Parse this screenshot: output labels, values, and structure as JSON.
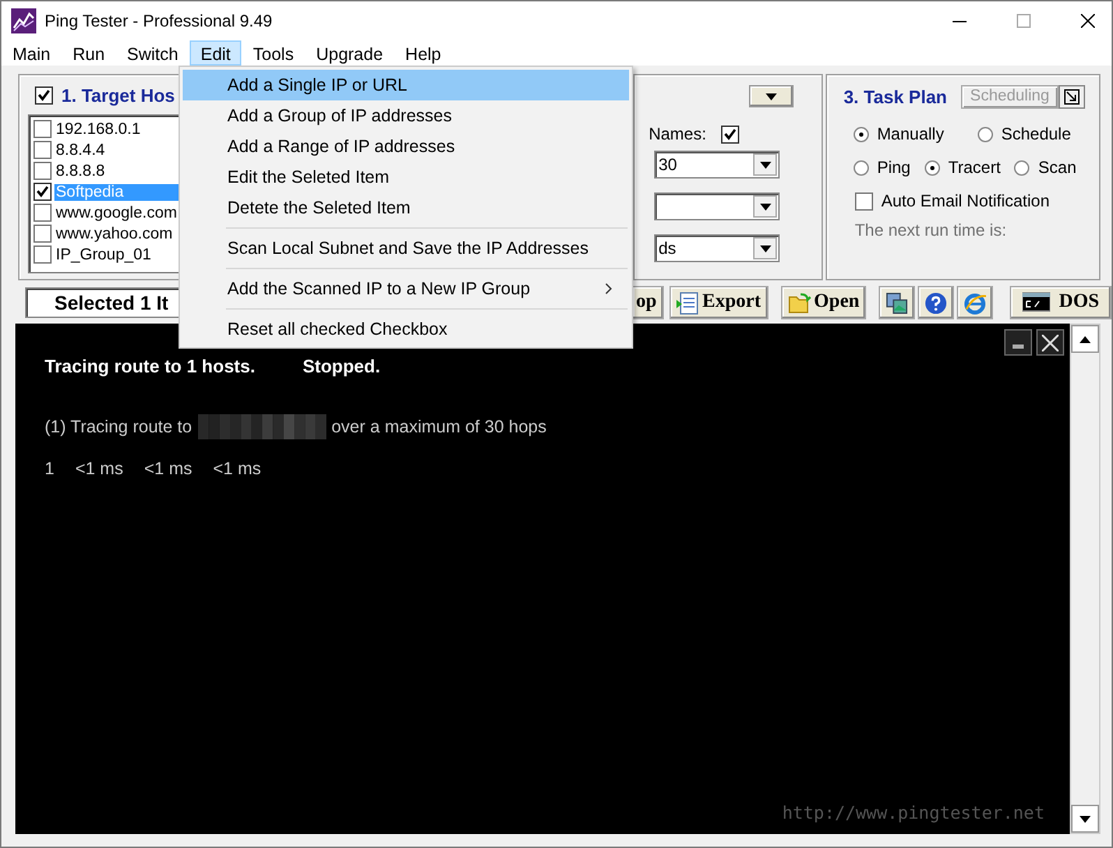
{
  "window": {
    "title": "Ping Tester - Professional  9.49"
  },
  "menu_bar": [
    {
      "label": "Main",
      "selected": false
    },
    {
      "label": "Run",
      "selected": false
    },
    {
      "label": "Switch",
      "selected": false
    },
    {
      "label": "Edit",
      "selected": true
    },
    {
      "label": "Tools",
      "selected": false
    },
    {
      "label": "Upgrade",
      "selected": false
    },
    {
      "label": "Help",
      "selected": false
    }
  ],
  "edit_menu": [
    {
      "kind": "item",
      "label": "Add a Single IP or URL",
      "selected": true
    },
    {
      "kind": "item",
      "label": "Add a Group of IP addresses",
      "selected": false
    },
    {
      "kind": "item",
      "label": "Add a Range of IP addresses",
      "selected": false
    },
    {
      "kind": "item",
      "label": "Edit the Seleted Item",
      "selected": false
    },
    {
      "kind": "item",
      "label": "Detete the Seleted Item",
      "selected": false
    },
    {
      "kind": "separator"
    },
    {
      "kind": "item",
      "label": "Scan Local Subnet and Save the IP Addresses",
      "selected": false
    },
    {
      "kind": "separator"
    },
    {
      "kind": "submenu",
      "label": "Add the Scanned IP to a New IP Group",
      "selected": false
    },
    {
      "kind": "separator"
    },
    {
      "kind": "item",
      "label": "Reset all checked Checkbox",
      "selected": false
    }
  ],
  "target_hosts": {
    "checked": true,
    "title": "1. Target Hos",
    "hosts": [
      {
        "label": "192.168.0.1",
        "checked": false,
        "selected": false
      },
      {
        "label": "8.8.4.4",
        "checked": false,
        "selected": false
      },
      {
        "label": "8.8.8.8",
        "checked": false,
        "selected": false
      },
      {
        "label": "Softpedia",
        "checked": true,
        "selected": true
      },
      {
        "label": "www.google.com",
        "checked": false,
        "selected": false
      },
      {
        "label": "www.yahoo.com",
        "checked": false,
        "selected": false
      },
      {
        "label": "IP_Group_01",
        "checked": false,
        "selected": false
      }
    ]
  },
  "options": {
    "names_label": "Names:",
    "names_checked": true,
    "dropdowns": [
      {
        "kind": "combo",
        "value": "30"
      },
      {
        "kind": "combo"
      },
      {
        "kind": "combo",
        "value": "ds"
      }
    ]
  },
  "task_plan": {
    "title": "3. Task Plan",
    "scheduling_button": {
      "label": "Scheduling",
      "disabled": true
    },
    "mode_options": [
      {
        "label": "Manually",
        "selected": true
      },
      {
        "label": "Schedule",
        "selected": false
      }
    ],
    "type_options": [
      {
        "label": "Ping",
        "selected": false
      },
      {
        "label": "Tracert",
        "selected": true
      },
      {
        "label": "Scan",
        "selected": false
      }
    ],
    "auto_email": {
      "label": "Auto Email Notification",
      "checked": false
    },
    "next_run_label": "The next run time is:"
  },
  "toolbar": {
    "selected_label": "Selected 1 It",
    "buttons": [
      {
        "kind": "text",
        "label": "op"
      },
      {
        "kind": "export",
        "label": "Export"
      },
      {
        "kind": "open",
        "label": "Open"
      },
      {
        "kind": "pictures"
      },
      {
        "kind": "help"
      },
      {
        "kind": "browser"
      },
      {
        "kind": "dos",
        "label": "DOS"
      }
    ]
  },
  "console": {
    "header": "Tracing route to 1 hosts.",
    "status": "Stopped.",
    "trace_line": {
      "before": "(1) Tracing route to",
      "after": "over a maximum of 30 hops"
    },
    "hops": [
      [
        "1",
        "<1 ms",
        "<1 ms",
        "<1 ms"
      ]
    ],
    "footer": "http://www.pingtester.net"
  }
}
